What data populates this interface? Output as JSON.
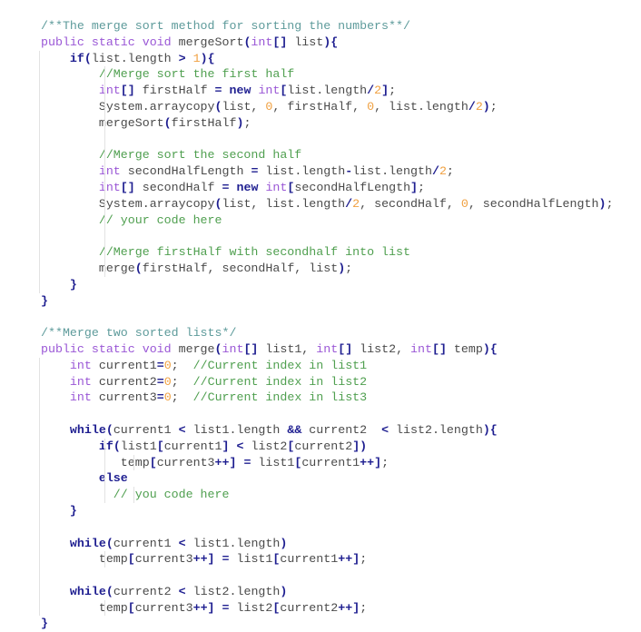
{
  "editor": {
    "language": "java",
    "lines": [
      {
        "indent": 0,
        "guides": [],
        "tokens": [
          [
            "doc",
            "/**The merge sort method for sorting the numbers**/"
          ]
        ]
      },
      {
        "indent": 0,
        "guides": [],
        "tokens": [
          [
            "kw",
            "public static void "
          ],
          [
            "txt",
            "mergeSort"
          ],
          [
            "op",
            "("
          ],
          [
            "kw",
            "int"
          ],
          [
            "op",
            "[]"
          ],
          [
            "txt",
            " list"
          ],
          [
            "op",
            ")"
          ],
          [
            "op",
            "{"
          ]
        ]
      },
      {
        "indent": 4,
        "guides": [
          0
        ],
        "tokens": [
          [
            "bkw",
            "if"
          ],
          [
            "op",
            "("
          ],
          [
            "txt",
            "list.length "
          ],
          [
            "op",
            ">"
          ],
          [
            "txt",
            " "
          ],
          [
            "num",
            "1"
          ],
          [
            "op",
            ")"
          ],
          [
            "op",
            "{"
          ]
        ]
      },
      {
        "indent": 8,
        "guides": [
          0,
          4
        ],
        "tokens": [
          [
            "cmt",
            "//Merge sort the first half"
          ]
        ]
      },
      {
        "indent": 8,
        "guides": [
          0,
          4
        ],
        "tokens": [
          [
            "kw",
            "int"
          ],
          [
            "op",
            "[]"
          ],
          [
            "txt",
            " firstHalf "
          ],
          [
            "op",
            "="
          ],
          [
            "txt",
            " "
          ],
          [
            "bkw",
            "new"
          ],
          [
            "txt",
            " "
          ],
          [
            "kw",
            "int"
          ],
          [
            "op",
            "["
          ],
          [
            "txt",
            "list.length"
          ],
          [
            "op",
            "/"
          ],
          [
            "num",
            "2"
          ],
          [
            "op",
            "]"
          ],
          [
            "txt",
            ";"
          ]
        ]
      },
      {
        "indent": 8,
        "guides": [
          0,
          4
        ],
        "tokens": [
          [
            "txt",
            "System.arraycopy"
          ],
          [
            "op",
            "("
          ],
          [
            "txt",
            "list, "
          ],
          [
            "num",
            "0"
          ],
          [
            "txt",
            ", firstHalf, "
          ],
          [
            "num",
            "0"
          ],
          [
            "txt",
            ", list.length"
          ],
          [
            "op",
            "/"
          ],
          [
            "num",
            "2"
          ],
          [
            "op",
            ")"
          ],
          [
            "txt",
            ";"
          ]
        ]
      },
      {
        "indent": 8,
        "guides": [
          0,
          4
        ],
        "tokens": [
          [
            "txt",
            "mergeSort"
          ],
          [
            "op",
            "("
          ],
          [
            "txt",
            "firstHalf"
          ],
          [
            "op",
            ")"
          ],
          [
            "txt",
            ";"
          ]
        ]
      },
      {
        "indent": 0,
        "guides": [
          0,
          4
        ],
        "tokens": []
      },
      {
        "indent": 8,
        "guides": [
          0,
          4
        ],
        "tokens": [
          [
            "cmt",
            "//Merge sort the second half"
          ]
        ]
      },
      {
        "indent": 8,
        "guides": [
          0,
          4
        ],
        "tokens": [
          [
            "kw",
            "int"
          ],
          [
            "txt",
            " secondHalfLength "
          ],
          [
            "op",
            "="
          ],
          [
            "txt",
            " list.length"
          ],
          [
            "op",
            "-"
          ],
          [
            "txt",
            "list.length"
          ],
          [
            "op",
            "/"
          ],
          [
            "num",
            "2"
          ],
          [
            "txt",
            ";"
          ]
        ]
      },
      {
        "indent": 8,
        "guides": [
          0,
          4
        ],
        "tokens": [
          [
            "kw",
            "int"
          ],
          [
            "op",
            "[]"
          ],
          [
            "txt",
            " secondHalf "
          ],
          [
            "op",
            "="
          ],
          [
            "txt",
            " "
          ],
          [
            "bkw",
            "new"
          ],
          [
            "txt",
            " "
          ],
          [
            "kw",
            "int"
          ],
          [
            "op",
            "["
          ],
          [
            "txt",
            "secondHalfLength"
          ],
          [
            "op",
            "]"
          ],
          [
            "txt",
            ";"
          ]
        ]
      },
      {
        "indent": 8,
        "guides": [
          0,
          4
        ],
        "tokens": [
          [
            "txt",
            "System.arraycopy"
          ],
          [
            "op",
            "("
          ],
          [
            "txt",
            "list, list.length"
          ],
          [
            "op",
            "/"
          ],
          [
            "num",
            "2"
          ],
          [
            "txt",
            ", secondHalf, "
          ],
          [
            "num",
            "0"
          ],
          [
            "txt",
            ", secondHalfLength"
          ],
          [
            "op",
            ")"
          ],
          [
            "txt",
            ";"
          ]
        ]
      },
      {
        "indent": 8,
        "guides": [
          0,
          4
        ],
        "tokens": [
          [
            "cmt",
            "// your code here"
          ]
        ]
      },
      {
        "indent": 0,
        "guides": [
          0,
          4
        ],
        "tokens": []
      },
      {
        "indent": 8,
        "guides": [
          0,
          4
        ],
        "tokens": [
          [
            "cmt",
            "//Merge firstHalf with secondhalf into list"
          ]
        ]
      },
      {
        "indent": 8,
        "guides": [
          0,
          4
        ],
        "tokens": [
          [
            "txt",
            "merge"
          ],
          [
            "op",
            "("
          ],
          [
            "txt",
            "firstHalf, secondHalf, list"
          ],
          [
            "op",
            ")"
          ],
          [
            "txt",
            ";"
          ]
        ]
      },
      {
        "indent": 4,
        "guides": [
          0
        ],
        "tokens": [
          [
            "op",
            "}"
          ]
        ]
      },
      {
        "indent": 0,
        "guides": [],
        "tokens": [
          [
            "op",
            "}"
          ]
        ]
      },
      {
        "indent": 0,
        "guides": [],
        "tokens": []
      },
      {
        "indent": 0,
        "guides": [],
        "tokens": [
          [
            "doc",
            "/**Merge two sorted lists*/"
          ]
        ]
      },
      {
        "indent": 0,
        "guides": [],
        "tokens": [
          [
            "kw",
            "public static void "
          ],
          [
            "txt",
            "merge"
          ],
          [
            "op",
            "("
          ],
          [
            "kw",
            "int"
          ],
          [
            "op",
            "[]"
          ],
          [
            "txt",
            " list1, "
          ],
          [
            "kw",
            "int"
          ],
          [
            "op",
            "[]"
          ],
          [
            "txt",
            " list2, "
          ],
          [
            "kw",
            "int"
          ],
          [
            "op",
            "[]"
          ],
          [
            "txt",
            " temp"
          ],
          [
            "op",
            ")"
          ],
          [
            "op",
            "{"
          ]
        ]
      },
      {
        "indent": 4,
        "guides": [
          0
        ],
        "tokens": [
          [
            "kw",
            "int"
          ],
          [
            "txt",
            " current1"
          ],
          [
            "op",
            "="
          ],
          [
            "num",
            "0"
          ],
          [
            "txt",
            ";  "
          ],
          [
            "cmt",
            "//Current index in list1"
          ]
        ]
      },
      {
        "indent": 4,
        "guides": [
          0
        ],
        "tokens": [
          [
            "kw",
            "int"
          ],
          [
            "txt",
            " current2"
          ],
          [
            "op",
            "="
          ],
          [
            "num",
            "0"
          ],
          [
            "txt",
            ";  "
          ],
          [
            "cmt",
            "//Current index in list2"
          ]
        ]
      },
      {
        "indent": 4,
        "guides": [
          0
        ],
        "tokens": [
          [
            "kw",
            "int"
          ],
          [
            "txt",
            " current3"
          ],
          [
            "op",
            "="
          ],
          [
            "num",
            "0"
          ],
          [
            "txt",
            ";  "
          ],
          [
            "cmt",
            "//Current index in list3"
          ]
        ]
      },
      {
        "indent": 0,
        "guides": [
          0
        ],
        "tokens": []
      },
      {
        "indent": 4,
        "guides": [
          0
        ],
        "tokens": [
          [
            "bkw",
            "while"
          ],
          [
            "op",
            "("
          ],
          [
            "txt",
            "current1 "
          ],
          [
            "op",
            "<"
          ],
          [
            "txt",
            " list1.length "
          ],
          [
            "op",
            "&&"
          ],
          [
            "txt",
            " current2  "
          ],
          [
            "op",
            "<"
          ],
          [
            "txt",
            " list2.length"
          ],
          [
            "op",
            ")"
          ],
          [
            "op",
            "{"
          ]
        ]
      },
      {
        "indent": 8,
        "guides": [
          0,
          4
        ],
        "tokens": [
          [
            "bkw",
            "if"
          ],
          [
            "op",
            "("
          ],
          [
            "txt",
            "list1"
          ],
          [
            "op",
            "["
          ],
          [
            "txt",
            "current1"
          ],
          [
            "op",
            "]"
          ],
          [
            "txt",
            " "
          ],
          [
            "op",
            "<"
          ],
          [
            "txt",
            " list2"
          ],
          [
            "op",
            "["
          ],
          [
            "txt",
            "current2"
          ],
          [
            "op",
            "])"
          ]
        ]
      },
      {
        "indent": 11,
        "guides": [
          0,
          4,
          8
        ],
        "tokens": [
          [
            "txt",
            "temp"
          ],
          [
            "op",
            "["
          ],
          [
            "txt",
            "current3"
          ],
          [
            "op",
            "++]"
          ],
          [
            "txt",
            " "
          ],
          [
            "op",
            "="
          ],
          [
            "txt",
            " list1"
          ],
          [
            "op",
            "["
          ],
          [
            "txt",
            "current1"
          ],
          [
            "op",
            "++]"
          ],
          [
            "txt",
            ";"
          ]
        ]
      },
      {
        "indent": 8,
        "guides": [
          0,
          4
        ],
        "tokens": [
          [
            "bkw",
            "else"
          ]
        ]
      },
      {
        "indent": 10,
        "guides": [
          0,
          4,
          8
        ],
        "tokens": [
          [
            "cmt",
            "// you code here"
          ]
        ]
      },
      {
        "indent": 4,
        "guides": [
          0
        ],
        "tokens": [
          [
            "op",
            "}"
          ]
        ]
      },
      {
        "indent": 0,
        "guides": [
          0
        ],
        "tokens": []
      },
      {
        "indent": 4,
        "guides": [
          0
        ],
        "tokens": [
          [
            "bkw",
            "while"
          ],
          [
            "op",
            "("
          ],
          [
            "txt",
            "current1 "
          ],
          [
            "op",
            "<"
          ],
          [
            "txt",
            " list1.length"
          ],
          [
            "op",
            ")"
          ]
        ]
      },
      {
        "indent": 8,
        "guides": [
          0,
          4
        ],
        "tokens": [
          [
            "txt",
            "temp"
          ],
          [
            "op",
            "["
          ],
          [
            "txt",
            "current3"
          ],
          [
            "op",
            "++]"
          ],
          [
            "txt",
            " "
          ],
          [
            "op",
            "="
          ],
          [
            "txt",
            " list1"
          ],
          [
            "op",
            "["
          ],
          [
            "txt",
            "current1"
          ],
          [
            "op",
            "++]"
          ],
          [
            "txt",
            ";"
          ]
        ]
      },
      {
        "indent": 0,
        "guides": [
          0
        ],
        "tokens": []
      },
      {
        "indent": 4,
        "guides": [
          0
        ],
        "tokens": [
          [
            "bkw",
            "while"
          ],
          [
            "op",
            "("
          ],
          [
            "txt",
            "current2 "
          ],
          [
            "op",
            "<"
          ],
          [
            "txt",
            " list2.length"
          ],
          [
            "op",
            ")"
          ]
        ]
      },
      {
        "indent": 8,
        "guides": [
          0,
          4
        ],
        "tokens": [
          [
            "txt",
            "temp"
          ],
          [
            "op",
            "["
          ],
          [
            "txt",
            "current3"
          ],
          [
            "op",
            "++]"
          ],
          [
            "txt",
            " "
          ],
          [
            "op",
            "="
          ],
          [
            "txt",
            " list2"
          ],
          [
            "op",
            "["
          ],
          [
            "txt",
            "current2"
          ],
          [
            "op",
            "++]"
          ],
          [
            "txt",
            ";"
          ]
        ]
      },
      {
        "indent": 0,
        "guides": [],
        "tokens": [
          [
            "op",
            "}"
          ]
        ]
      }
    ]
  }
}
